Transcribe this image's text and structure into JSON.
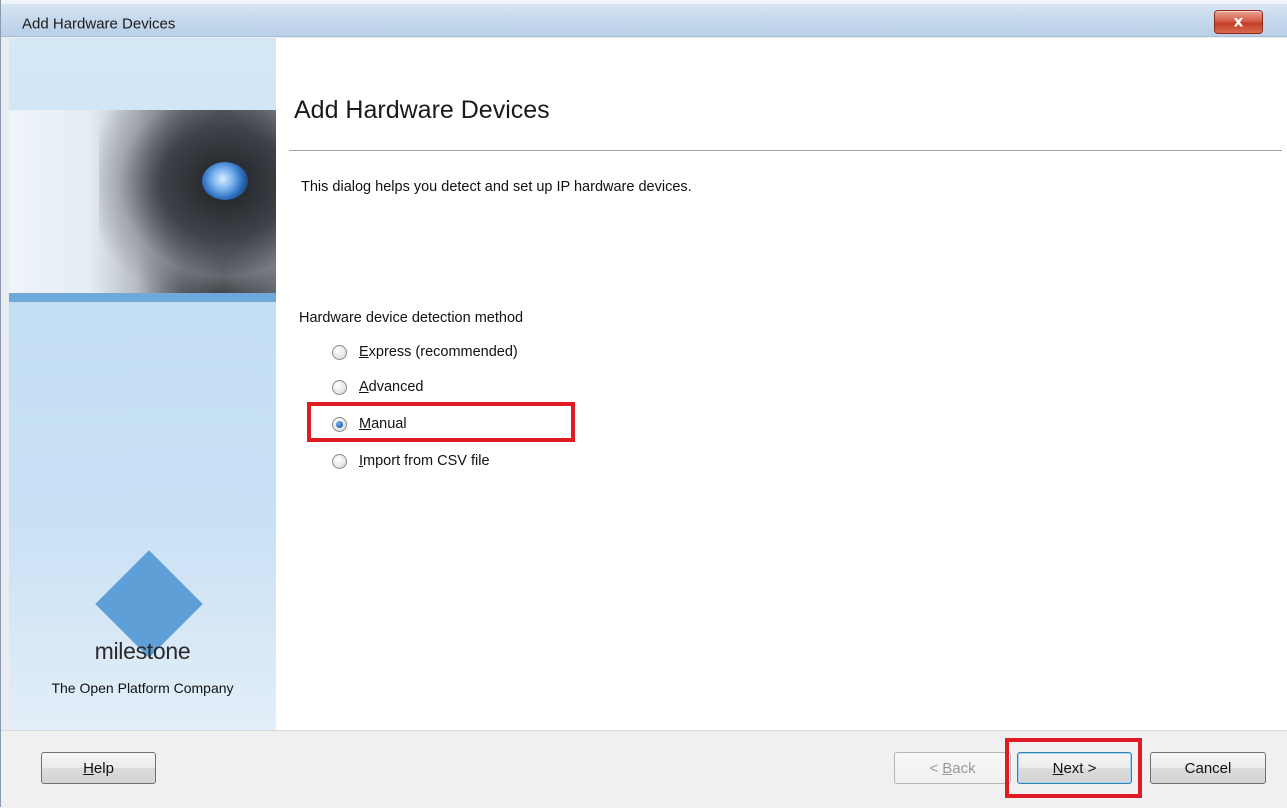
{
  "window": {
    "title": "Add Hardware Devices",
    "close_glyph": "x"
  },
  "banner": {
    "logo_text": "milestone",
    "tagline": "The Open Platform Company"
  },
  "main": {
    "heading": "Add Hardware Devices",
    "description": "This dialog helps you detect and set up IP hardware devices.",
    "group_label": "Hardware device detection method",
    "options": [
      {
        "label_mnemonic": "E",
        "label_rest": "xpress (recommended)",
        "checked": false
      },
      {
        "label_mnemonic": "A",
        "label_rest": "dvanced",
        "checked": false
      },
      {
        "label_mnemonic": "M",
        "label_rest": "anual",
        "checked": true
      },
      {
        "label_mnemonic": "I",
        "label_rest": "mport from CSV file",
        "checked": false
      }
    ]
  },
  "footer": {
    "help": {
      "mnemonic": "H",
      "rest": "elp"
    },
    "back": {
      "prefix": "< ",
      "mnemonic": "B",
      "rest": "ack",
      "disabled": true
    },
    "next": {
      "mnemonic": "N",
      "rest": "ext >"
    },
    "cancel": "Cancel"
  },
  "colors": {
    "highlight": "#e01b24",
    "accent": "#5f9fd8"
  }
}
